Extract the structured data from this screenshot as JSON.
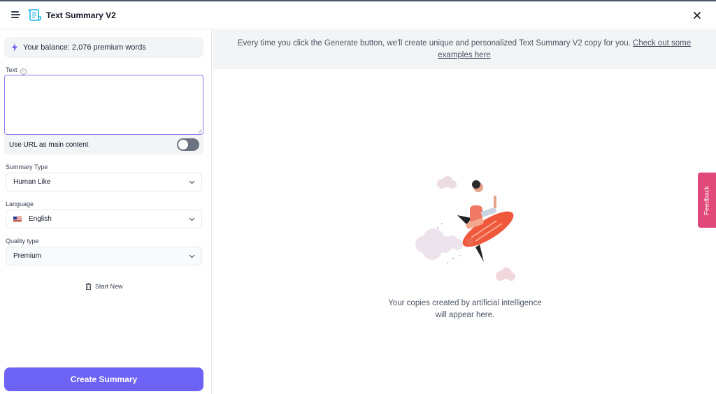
{
  "header": {
    "title": "Text Summary V2",
    "menu_icon": "hamburger-menu-icon",
    "app_icon": "scroll-document-icon",
    "close_icon": "close-icon"
  },
  "sidebar": {
    "balance_text": "Your balance: 2,076 premium words",
    "text_label": "Text",
    "text_value": "",
    "use_url_label": "Use URL as main content",
    "use_url_enabled": false,
    "summary_type_label": "Summary Type",
    "summary_type_value": "Human Like",
    "language_label": "Language",
    "language_value": "English",
    "quality_label": "Quality type",
    "quality_value": "Premium",
    "start_new_label": "Start New",
    "create_button_label": "Create Summary"
  },
  "main": {
    "notice_text": "Every time you click the Generate button, we'll create unique and personalized Text Summary V2 copy for you. ",
    "notice_link": "Check out some examples here",
    "empty_line1": "Your copies created by artificial intelligence",
    "empty_line2": "will appear here."
  },
  "feedback_label": "Feedback",
  "colors": {
    "accent": "#6c63f4",
    "feedback": "#e0497a",
    "textarea_border": "#8b7cf6",
    "app_icon": "#1fb6e8"
  }
}
